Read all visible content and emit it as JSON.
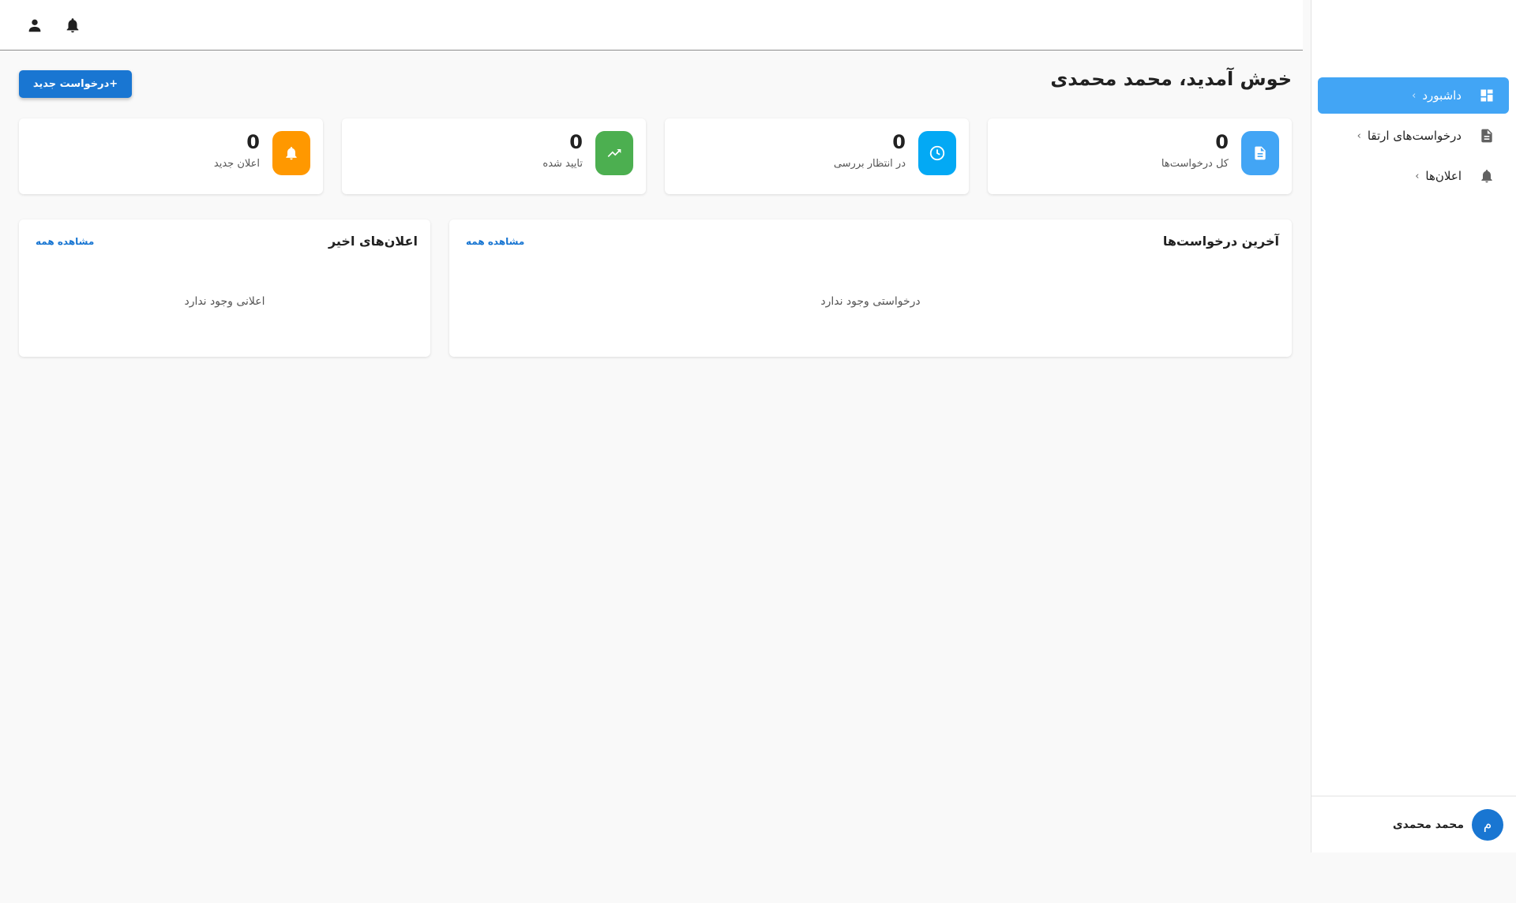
{
  "topbar": {
    "profile_icon": "person-icon",
    "notifications_icon": "bell-icon"
  },
  "sidebar": {
    "items": [
      {
        "label": "داشبورد",
        "icon": "dashboard-icon",
        "active": true
      },
      {
        "label": "درخواست‌های ارتقا",
        "icon": "document-icon",
        "active": false
      },
      {
        "label": "اعلان‌ها",
        "icon": "bell-icon",
        "active": false
      }
    ],
    "chevron": "‹",
    "user": {
      "avatar_letter": "م",
      "name": "محمد محمدی"
    }
  },
  "header": {
    "title": "خوش آمدید، محمد محمدی",
    "new_request_button": "+درخواست جدید"
  },
  "stats": [
    {
      "value": "0",
      "label": "کل درخواست‌ها",
      "icon": "document-icon",
      "color": "#42a5f5"
    },
    {
      "value": "0",
      "label": "در انتظار بررسی",
      "icon": "clock-icon",
      "color": "#03a9f4"
    },
    {
      "value": "0",
      "label": "تایید شده",
      "icon": "trending-up-icon",
      "color": "#4caf50"
    },
    {
      "value": "0",
      "label": "اعلان جدید",
      "icon": "bell-icon",
      "color": "#ff9800"
    }
  ],
  "panels": {
    "recent_requests": {
      "title": "آخرین درخواست‌ها",
      "link": "مشاهده همه",
      "empty": "درخواستی وجود ندارد"
    },
    "recent_notifications": {
      "title": "اعلان‌های اخیر",
      "link": "مشاهده همه",
      "empty": "اعلانی وجود ندارد"
    }
  },
  "colors": {
    "primary": "#1976d2",
    "active_nav": "#42a5f5",
    "background": "#f9f9f9"
  }
}
